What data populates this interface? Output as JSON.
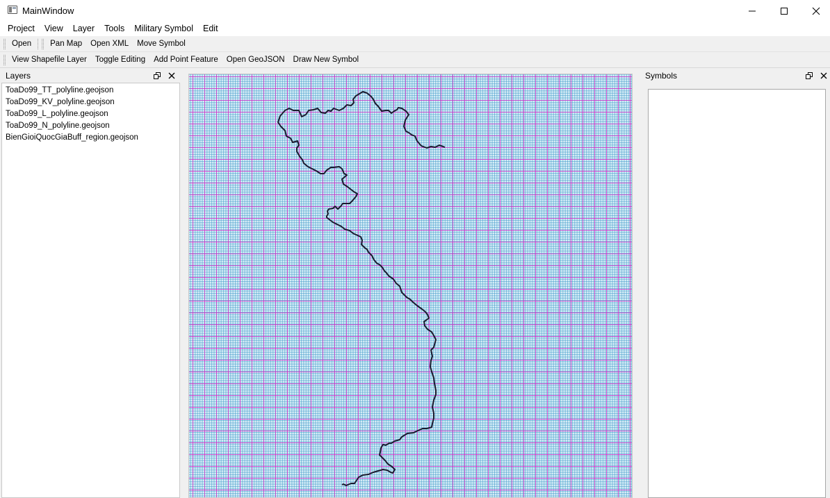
{
  "window": {
    "title": "MainWindow"
  },
  "menu": {
    "items": [
      {
        "label": "Project"
      },
      {
        "label": "View"
      },
      {
        "label": "Layer"
      },
      {
        "label": "Tools"
      },
      {
        "label": "Military Symbol"
      },
      {
        "label": "Edit"
      }
    ]
  },
  "toolbar1": {
    "open": "Open",
    "pan_map": "Pan Map",
    "open_xml": "Open XML",
    "move_symbol": "Move Symbol"
  },
  "toolbar2": {
    "view_shapefile": "View Shapefile Layer",
    "toggle_editing": "Toggle Editing",
    "add_point_feature": "Add Point Feature",
    "open_geojson": "Open GeoJSON",
    "draw_new_symbol": "Draw New Symbol"
  },
  "layers_dock": {
    "title": "Layers",
    "items": [
      "ToaDo99_TT_polyline.geojson",
      "ToaDo99_KV_polyline.geojson",
      "ToaDo99_L_polyline.geojson",
      "ToaDo99_N_polyline.geojson",
      "BienGioiQuocGiaBuff_region.geojson"
    ]
  },
  "symbols_dock": {
    "title": "Symbols"
  },
  "colors": {
    "grid_major": "#dc28c8",
    "grid_minor": "#3c96c8",
    "map_background": "#d8eef7",
    "border_line": "#1a1a2e"
  }
}
